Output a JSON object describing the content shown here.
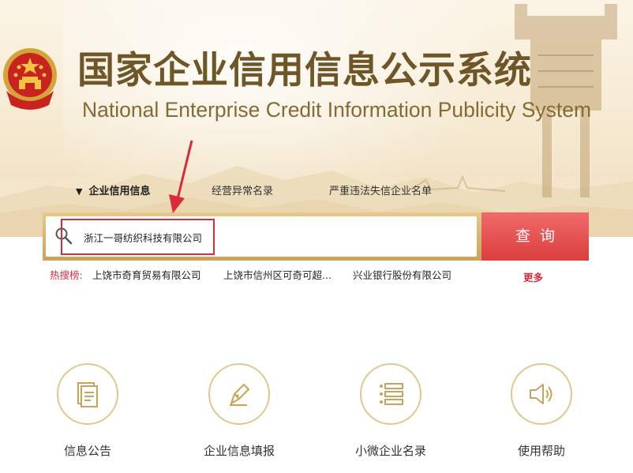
{
  "header": {
    "title_cn": "国家企业信用信息公示系统",
    "title_en": "National Enterprise Credit Information Publicity System",
    "emblem": "national-emblem-icon"
  },
  "tabs": [
    {
      "label": "企业信用信息",
      "active": true
    },
    {
      "label": "经营异常名录",
      "active": false
    },
    {
      "label": "严重违法失信企业名单",
      "active": false
    }
  ],
  "search": {
    "value": "浙江一哥纺织科技有限公司",
    "button_label": "查询",
    "icon": "search-icon"
  },
  "hot_searches": {
    "label": "热搜榜:",
    "items": [
      "上饶市奇育贸易有限公司",
      "上饶市信州区可奇可超...",
      "兴业银行股份有限公司"
    ],
    "more_label": "更多"
  },
  "services": [
    {
      "label": "信息公告",
      "icon": "document-icon"
    },
    {
      "label": "企业信息填报",
      "icon": "pen-icon"
    },
    {
      "label": "小微企业名录",
      "icon": "list-icon"
    },
    {
      "label": "使用帮助",
      "icon": "speaker-icon"
    }
  ],
  "colors": {
    "accent_red": "#dc3e3e",
    "gold": "#c9a35a",
    "title_brown": "#6e5626"
  }
}
